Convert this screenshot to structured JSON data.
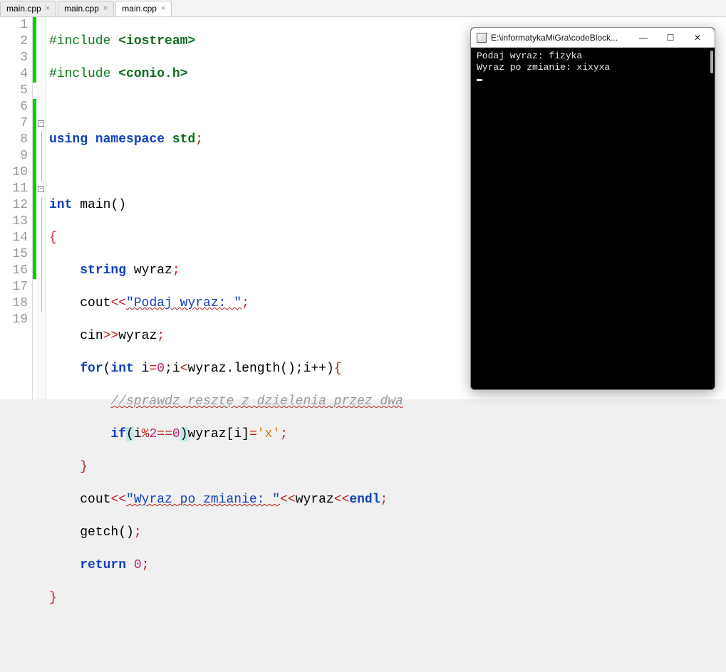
{
  "tabs": [
    {
      "label": "main.cpp",
      "active": false
    },
    {
      "label": "main.cpp",
      "active": false
    },
    {
      "label": "main.cpp",
      "active": true
    }
  ],
  "line_numbers": [
    "1",
    "2",
    "3",
    "4",
    "5",
    "6",
    "7",
    "8",
    "9",
    "10",
    "11",
    "12",
    "13",
    "14",
    "15",
    "16",
    "17",
    "18",
    "19"
  ],
  "code": {
    "l1": {
      "pp": "#include ",
      "inc": "<iostream>"
    },
    "l2": {
      "pp": "#include ",
      "inc": "<conio.h>"
    },
    "l4_using": "using",
    "l4_ns": "namespace",
    "l4_std": "std",
    "semi": ";",
    "l6_int": "int",
    "l6_main": "main",
    "l6_par": "()",
    "l7_brace": "{",
    "l8_string": "string",
    "l8_var": "wyraz",
    "l9_cout": "cout",
    "l9_op": "<<",
    "l9_str": "\"Podaj wyraz: \"",
    "l10_cin": "cin",
    "l10_op": ">>",
    "l10_var": "wyraz",
    "l11_for": "for",
    "l11_int": "int",
    "l11_body": "i",
    "l11_eq": "=",
    "l11_zero": "0",
    "l11_lt": "<",
    "l11_call": "wyraz.length()",
    "l11_inc": "i++",
    "l11_brace": "{",
    "l12_cmt": "//sprawdz resztę z dzielenia przez dwa",
    "l13_if": "if",
    "l13_cond_l": "(",
    "l13_i": "i",
    "l13_mod": "%",
    "l13_two": "2",
    "l13_eqeq": "==",
    "l13_z": "0",
    "l13_cond_r": ")",
    "l13_arr": "wyraz[i]",
    "l13_asgn": "=",
    "l13_ch": "'x'",
    "l14_brace": "}",
    "l15_cout": "cout",
    "l15_op": "<<",
    "l15_str": "\"Wyraz po zmianie: \"",
    "l15_var": "wyraz",
    "l15_endl": "endl",
    "l16_getch": "getch",
    "l16_par": "()",
    "l17_return": "return",
    "l17_zero": "0",
    "l18_brace": "}"
  },
  "console": {
    "title": "E:\\informatykaMiGra\\codeBlock...",
    "lines": [
      "Podaj wyraz: fizyka",
      "Wyraz po zmianie: xixyxa"
    ],
    "buttons": {
      "min": "—",
      "max": "☐",
      "close": "✕"
    }
  }
}
